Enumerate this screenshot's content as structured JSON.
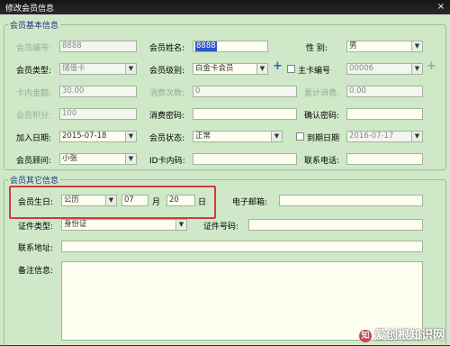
{
  "window": {
    "title": "修改会员信息",
    "close": "×"
  },
  "basic": {
    "title": "会员基本信息",
    "member_no": {
      "label": "会员编号:",
      "value": "8888"
    },
    "member_name": {
      "label": "会员姓名:",
      "value": "8888"
    },
    "gender": {
      "label": "性    别:",
      "value": "男"
    },
    "member_type": {
      "label": "会员类型:",
      "value": "储值卡"
    },
    "member_level": {
      "label": "会员级别:",
      "value": "白金卡会员"
    },
    "main_card": {
      "label": "主卡编号",
      "value": "00006"
    },
    "card_balance": {
      "label": "卡内金额:",
      "value": "30.00"
    },
    "consume_count": {
      "label": "消费次数:",
      "value": "0"
    },
    "total_consume": {
      "label": "累计消费:",
      "value": "0.00"
    },
    "points": {
      "label": "会员积分:",
      "value": "100"
    },
    "consume_password": {
      "label": "消费密码:",
      "value": ""
    },
    "confirm_password": {
      "label": "确认密码:",
      "value": ""
    },
    "join_date": {
      "label": "加入日期:",
      "value": "2015-07-18"
    },
    "member_status": {
      "label": "会员状态:",
      "value": "正常"
    },
    "expire_date": {
      "label": "到期日期",
      "value": "2016-07-17"
    },
    "consultant": {
      "label": "会员顾问:",
      "value": "小张"
    },
    "id_card_no": {
      "label": "ID卡内码:",
      "value": ""
    },
    "phone": {
      "label": "联系电话:",
      "value": ""
    }
  },
  "other": {
    "title": "会员其它信息",
    "birthday": {
      "label": "会员生日:",
      "calendar": "公历",
      "month": "07",
      "month_unit": "月",
      "day": "20",
      "day_unit": "日"
    },
    "email": {
      "label": "电子邮箱:",
      "value": ""
    },
    "id_type": {
      "label": "证件类型:",
      "value": "身份证"
    },
    "id_no": {
      "label": "证件号码:",
      "value": ""
    },
    "address": {
      "label": "联系地址:",
      "value": ""
    },
    "remark": {
      "label": "备注信息:",
      "value": ""
    }
  },
  "icons": {
    "plus": "+",
    "dropdown": "▼"
  },
  "watermark": {
    "logo": "知",
    "text": "爱创根知识网"
  }
}
